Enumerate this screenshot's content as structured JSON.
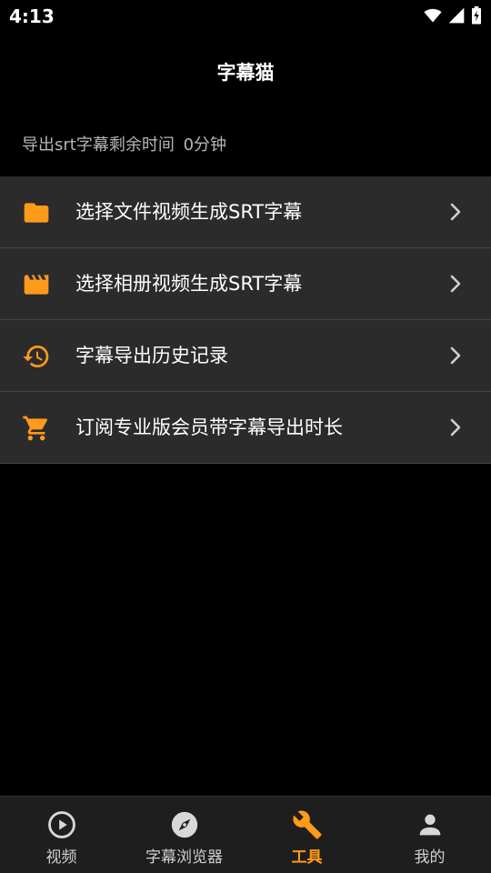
{
  "status_bar": {
    "time": "4:13"
  },
  "header": {
    "title": "字幕猫"
  },
  "remaining": {
    "label": "导出srt字幕剩余时间",
    "value": "0分钟"
  },
  "menu": {
    "items": [
      {
        "label": "选择文件视频生成SRT字幕",
        "icon": "folder-icon"
      },
      {
        "label": "选择相册视频生成SRT字幕",
        "icon": "clapperboard-icon"
      },
      {
        "label": "字幕导出历史记录",
        "icon": "history-icon"
      },
      {
        "label": "订阅专业版会员带字幕导出时长",
        "icon": "cart-icon"
      }
    ]
  },
  "bottom_nav": {
    "items": [
      {
        "label": "视频",
        "icon": "play-circle-icon"
      },
      {
        "label": "字幕浏览器",
        "icon": "compass-icon"
      },
      {
        "label": "工具",
        "icon": "wrench-icon",
        "active": true
      },
      {
        "label": "我的",
        "icon": "person-icon"
      }
    ]
  },
  "colors": {
    "accent": "#ff9a1a",
    "background": "#000000",
    "row": "#2b2b2b",
    "nav_bg": "#1e1e1e"
  }
}
